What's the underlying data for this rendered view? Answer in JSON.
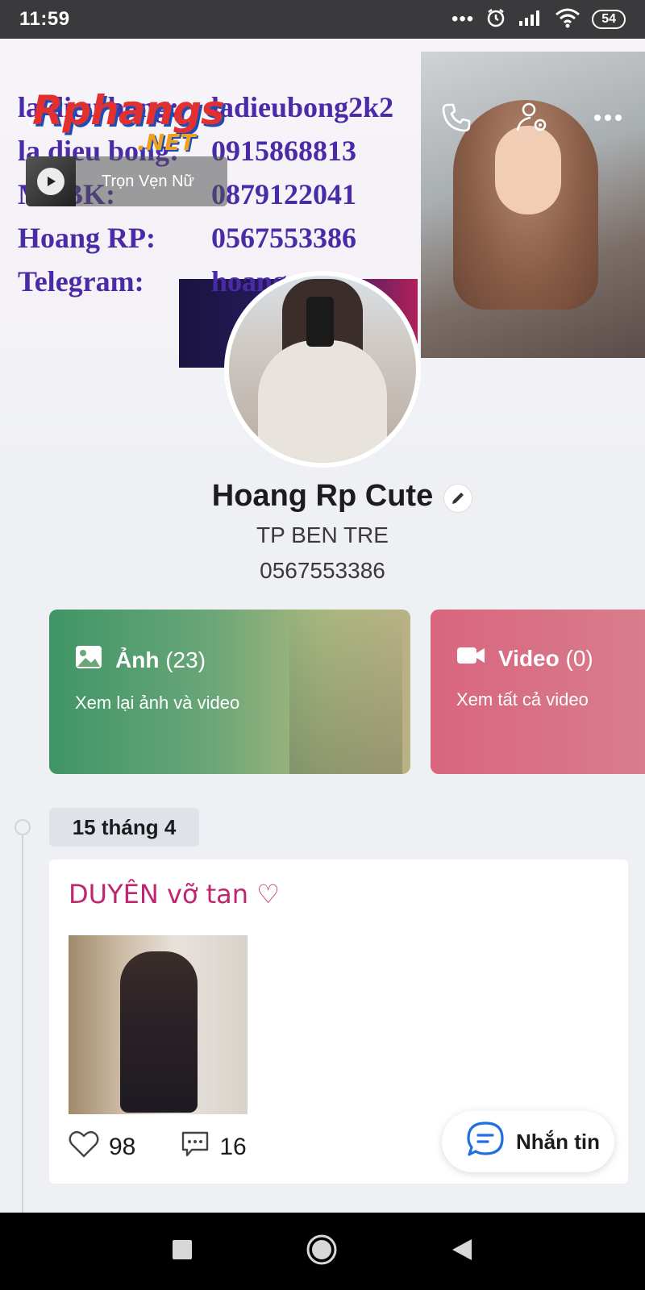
{
  "status_bar": {
    "time": "11:59",
    "dots": "•••",
    "battery": "54"
  },
  "cover": {
    "lines": [
      {
        "key": "la dieu bong:",
        "value": "ladieubong2k2"
      },
      {
        "key": "la dieu bong:",
        "value": "0915868813"
      },
      {
        "key": "MI BK:",
        "value": "0879122041"
      },
      {
        "key": "Hoang RP:",
        "value": "0567553386"
      },
      {
        "key": "Telegram:",
        "value": "hoangrp"
      }
    ],
    "watermark": "Rphangs",
    "watermark_sub": ".NET"
  },
  "music": {
    "title": "Trọn Vẹn Nữ"
  },
  "profile": {
    "name": "Hoang Rp Cute",
    "location": "TP BEN TRE",
    "phone": "0567553386"
  },
  "media": {
    "photos": {
      "label": "Ảnh",
      "count": "(23)",
      "subtitle": "Xem lại ảnh và video"
    },
    "videos": {
      "label": "Video",
      "count": "(0)",
      "subtitle": "Xem tất cả video"
    }
  },
  "timeline": {
    "date": "15 tháng 4"
  },
  "post": {
    "text": "DUYÊN vỡ tan ♡",
    "likes": "98",
    "comments": "16"
  },
  "message_button": {
    "label": "Nhắn tin"
  },
  "colors": {
    "accent_pink": "#c0266e",
    "photos_green": "#3f9566",
    "videos_red": "#d9657e",
    "cover_text": "#4b2aa8"
  }
}
